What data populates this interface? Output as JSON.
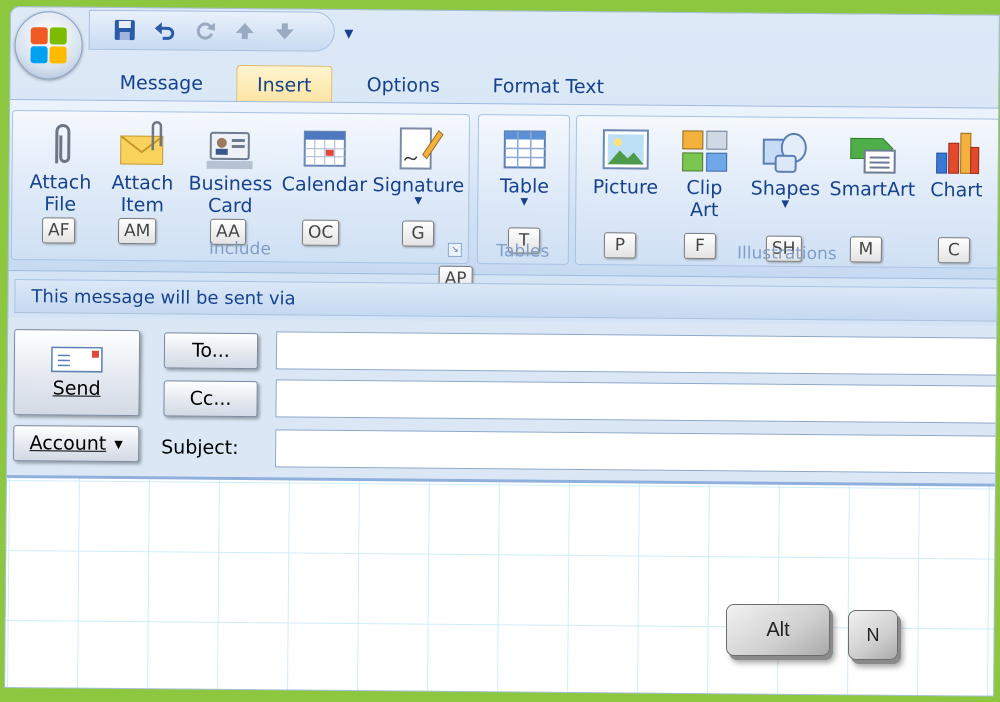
{
  "colors": {
    "background": "#8dc63f",
    "accent": "#15428b",
    "active_tab": "#fbe3a2"
  },
  "quick_access": {
    "icons": [
      "save-icon",
      "undo-icon",
      "redo-icon",
      "up-arrow-icon",
      "down-arrow-icon"
    ],
    "customize_glyph": "▾"
  },
  "tabs": [
    {
      "label": "Message"
    },
    {
      "label": "Insert",
      "active": true
    },
    {
      "label": "Options"
    },
    {
      "label": "Format Text"
    }
  ],
  "ribbon": {
    "include": {
      "label": "Include",
      "buttons": [
        {
          "label": "Attach\nFile",
          "keytip": "AF",
          "icon": "paperclip-icon"
        },
        {
          "label": "Attach\nItem",
          "keytip": "AM",
          "icon": "envelope-clip-icon"
        },
        {
          "label": "Business\nCard",
          "keytip": "AA",
          "icon": "business-card-icon"
        },
        {
          "label": "Calendar",
          "keytip": "OC",
          "icon": "calendar-icon"
        },
        {
          "label": "Signature",
          "keytip": "G",
          "icon": "signature-icon"
        }
      ],
      "launcher_keytip": "AP"
    },
    "tables": {
      "label": "Tables",
      "buttons": [
        {
          "label": "Table",
          "keytip": "T",
          "icon": "table-icon"
        }
      ]
    },
    "illustrations": {
      "label": "Illustrations",
      "buttons": [
        {
          "label": "Picture",
          "keytip": "P",
          "icon": "picture-icon"
        },
        {
          "label": "Clip\nArt",
          "keytip": "F",
          "icon": "clipart-icon"
        },
        {
          "label": "Shapes",
          "keytip": "SH",
          "icon": "shapes-icon"
        },
        {
          "label": "SmartArt",
          "keytip": "M",
          "icon": "smartart-icon"
        },
        {
          "label": "Chart",
          "keytip": "C",
          "icon": "chart-icon"
        }
      ]
    }
  },
  "infobar": {
    "text": "This message will be sent via"
  },
  "compose": {
    "send_label": "Send",
    "account_label": "Account",
    "to_label": "To...",
    "cc_label": "Cc...",
    "subject_label": "Subject:",
    "to_value": "",
    "cc_value": "",
    "subject_value": ""
  },
  "keyboard_keys": {
    "alt": "Alt",
    "n": "N"
  }
}
